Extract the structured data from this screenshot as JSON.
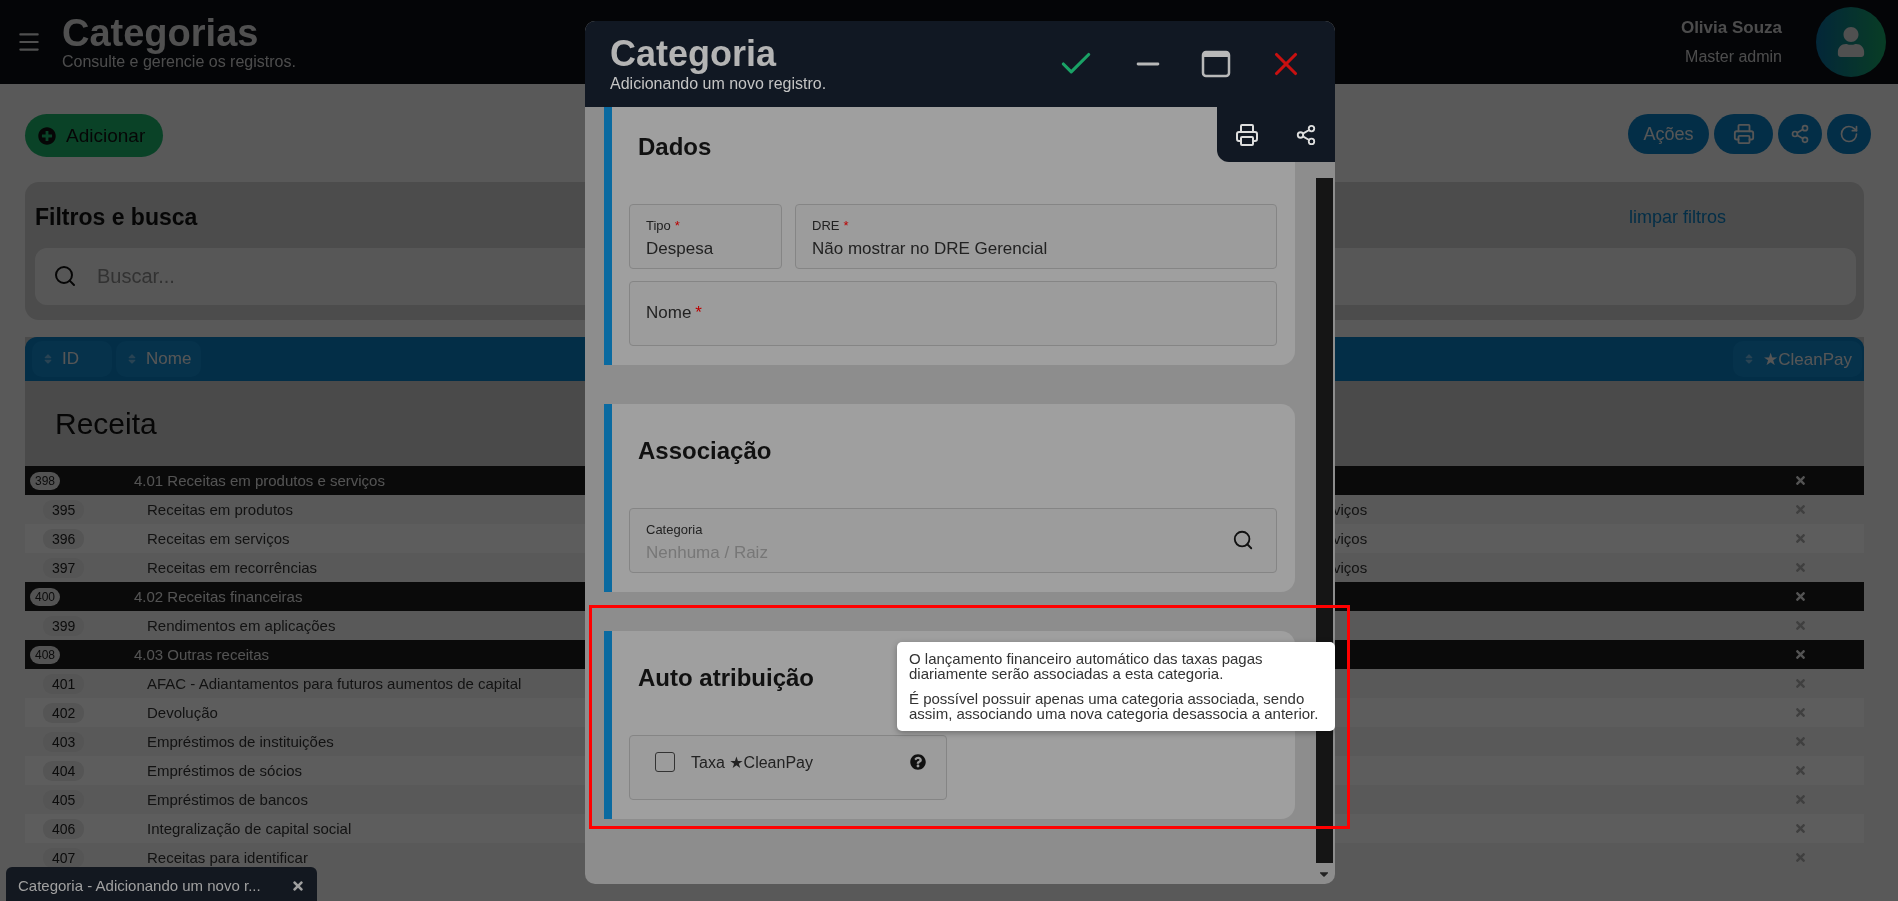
{
  "app_header": {
    "title": "Categorias",
    "subtitle": "Consulte e gerencie os registros.",
    "user": {
      "name": "Olivia Souza",
      "role": "Master admin"
    }
  },
  "toolbar": {
    "add_button": "Adicionar",
    "actions_button": "Ações"
  },
  "filters": {
    "title": "Filtros e busca",
    "clear_link": "limpar filtros",
    "search": {
      "placeholder": "Buscar..."
    }
  },
  "table": {
    "columns": [
      {
        "label": "ID"
      },
      {
        "label": "Nome"
      },
      {
        "label": "★CleanPay"
      }
    ],
    "group_title": "Receita",
    "rows": [
      {
        "kind": "group",
        "id": "398",
        "name": "4.01 Receitas em produtos e serviços"
      },
      {
        "kind": "item",
        "id": "395",
        "name": "Receitas em produtos",
        "column_3": "viços"
      },
      {
        "kind": "item",
        "id": "396",
        "name": "Receitas em serviços",
        "column_3": "viços"
      },
      {
        "kind": "item",
        "id": "397",
        "name": "Receitas em recorrências",
        "column_3": "viços"
      },
      {
        "kind": "group",
        "id": "400",
        "name": "4.02 Receitas financeiras"
      },
      {
        "kind": "item",
        "id": "399",
        "name": "Rendimentos em aplicações"
      },
      {
        "kind": "group",
        "id": "408",
        "name": "4.03 Outras receitas"
      },
      {
        "kind": "item",
        "id": "401",
        "name": "AFAC - Adiantamentos para futuros aumentos de capital"
      },
      {
        "kind": "item",
        "id": "402",
        "name": "Devolução"
      },
      {
        "kind": "item",
        "id": "403",
        "name": "Empréstimos de instituições"
      },
      {
        "kind": "item",
        "id": "404",
        "name": "Empréstimos de sócios"
      },
      {
        "kind": "item",
        "id": "405",
        "name": "Empréstimos de bancos"
      },
      {
        "kind": "item",
        "id": "406",
        "name": "Integralização de capital social"
      },
      {
        "kind": "item",
        "id": "407",
        "name": "Receitas para identificar"
      }
    ]
  },
  "taskbar": [
    {
      "label": "Categoria - Adicionando um novo r..."
    }
  ],
  "modal": {
    "title": "Categoria",
    "subtitle": "Adicionando um novo registro.",
    "sections": [
      {
        "title": "Dados",
        "fields": [
          {
            "kind": "select",
            "label": "Tipo",
            "required_mark": "*",
            "value": "Despesa"
          },
          {
            "kind": "select",
            "label": "DRE",
            "required_mark": "*",
            "value": "Não mostrar no DRE Gerencial"
          },
          {
            "kind": "text",
            "label": "Nome",
            "required_mark": "*"
          }
        ]
      },
      {
        "title": "Associação",
        "fields": [
          {
            "kind": "lookup",
            "label": "Categoria",
            "placeholder": "Nenhuma / Raiz"
          }
        ]
      },
      {
        "title": "Auto atribuição",
        "fields": [
          {
            "kind": "checkbox",
            "label": "Taxa ★CleanPay",
            "checked": false
          }
        ]
      }
    ],
    "tooltip": {
      "paragraphs": [
        "O lançamento financeiro automático das taxas pagas diariamente serão associadas a esta categoria.",
        "É possível possuir apenas uma categoria associada, sendo assim, associando uma nova categoria desassocia a anterior."
      ]
    }
  }
}
